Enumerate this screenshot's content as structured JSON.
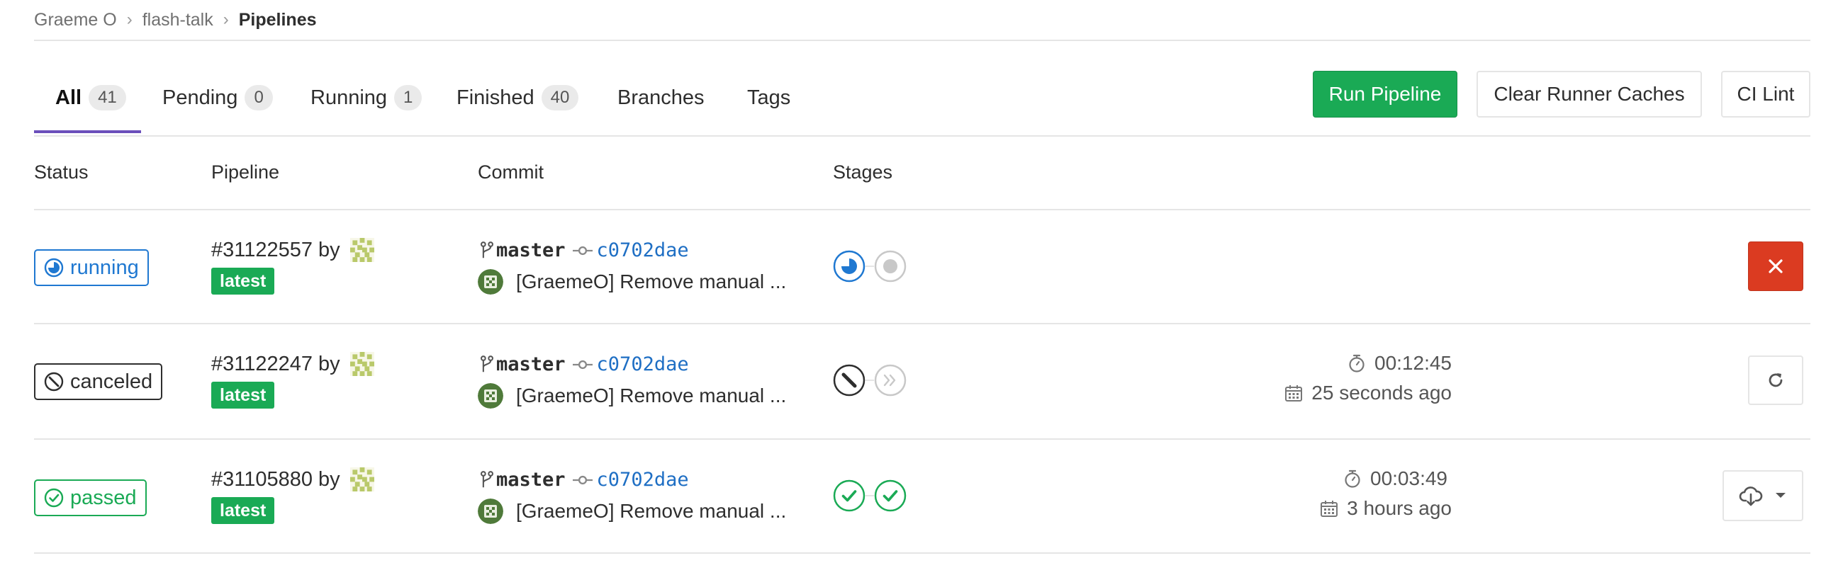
{
  "breadcrumb": {
    "user": "Graeme O",
    "project": "flash-talk",
    "current": "Pipelines"
  },
  "tabs": [
    {
      "label": "All",
      "count": "41"
    },
    {
      "label": "Pending",
      "count": "0"
    },
    {
      "label": "Running",
      "count": "1"
    },
    {
      "label": "Finished",
      "count": "40"
    },
    {
      "label": "Branches"
    },
    {
      "label": "Tags"
    }
  ],
  "actions": {
    "run_pipeline": "Run Pipeline",
    "clear_caches": "Clear Runner Caches",
    "ci_lint": "CI Lint"
  },
  "columns": {
    "status": "Status",
    "pipeline": "Pipeline",
    "commit": "Commit",
    "stages": "Stages"
  },
  "colors": {
    "accent": "#6b4fbb",
    "success": "#1aaa55",
    "running": "#1f78d1",
    "danger": "#db3b21",
    "link": "#1f6fc4"
  },
  "pipelines": [
    {
      "status": "running",
      "id": "#31122557",
      "by": "by",
      "tag": "latest",
      "branch": "master",
      "sha": "c0702dae",
      "message": "[GraemeO] Remove manual ...",
      "stages": [
        "running",
        "created"
      ],
      "action_icon": "close-icon"
    },
    {
      "status": "canceled",
      "id": "#31122247",
      "by": "by",
      "tag": "latest",
      "branch": "master",
      "sha": "c0702dae",
      "message": "[GraemeO] Remove manual ...",
      "stages": [
        "canceled",
        "skipped"
      ],
      "duration": "00:12:45",
      "finished": "25 seconds ago",
      "action_icon": "retry-icon"
    },
    {
      "status": "passed",
      "id": "#31105880",
      "by": "by",
      "tag": "latest",
      "branch": "master",
      "sha": "c0702dae",
      "message": "[GraemeO] Remove manual ...",
      "stages": [
        "passed",
        "passed"
      ],
      "duration": "00:03:49",
      "finished": "3 hours ago",
      "action_icon": "download-cloud-icon"
    }
  ]
}
